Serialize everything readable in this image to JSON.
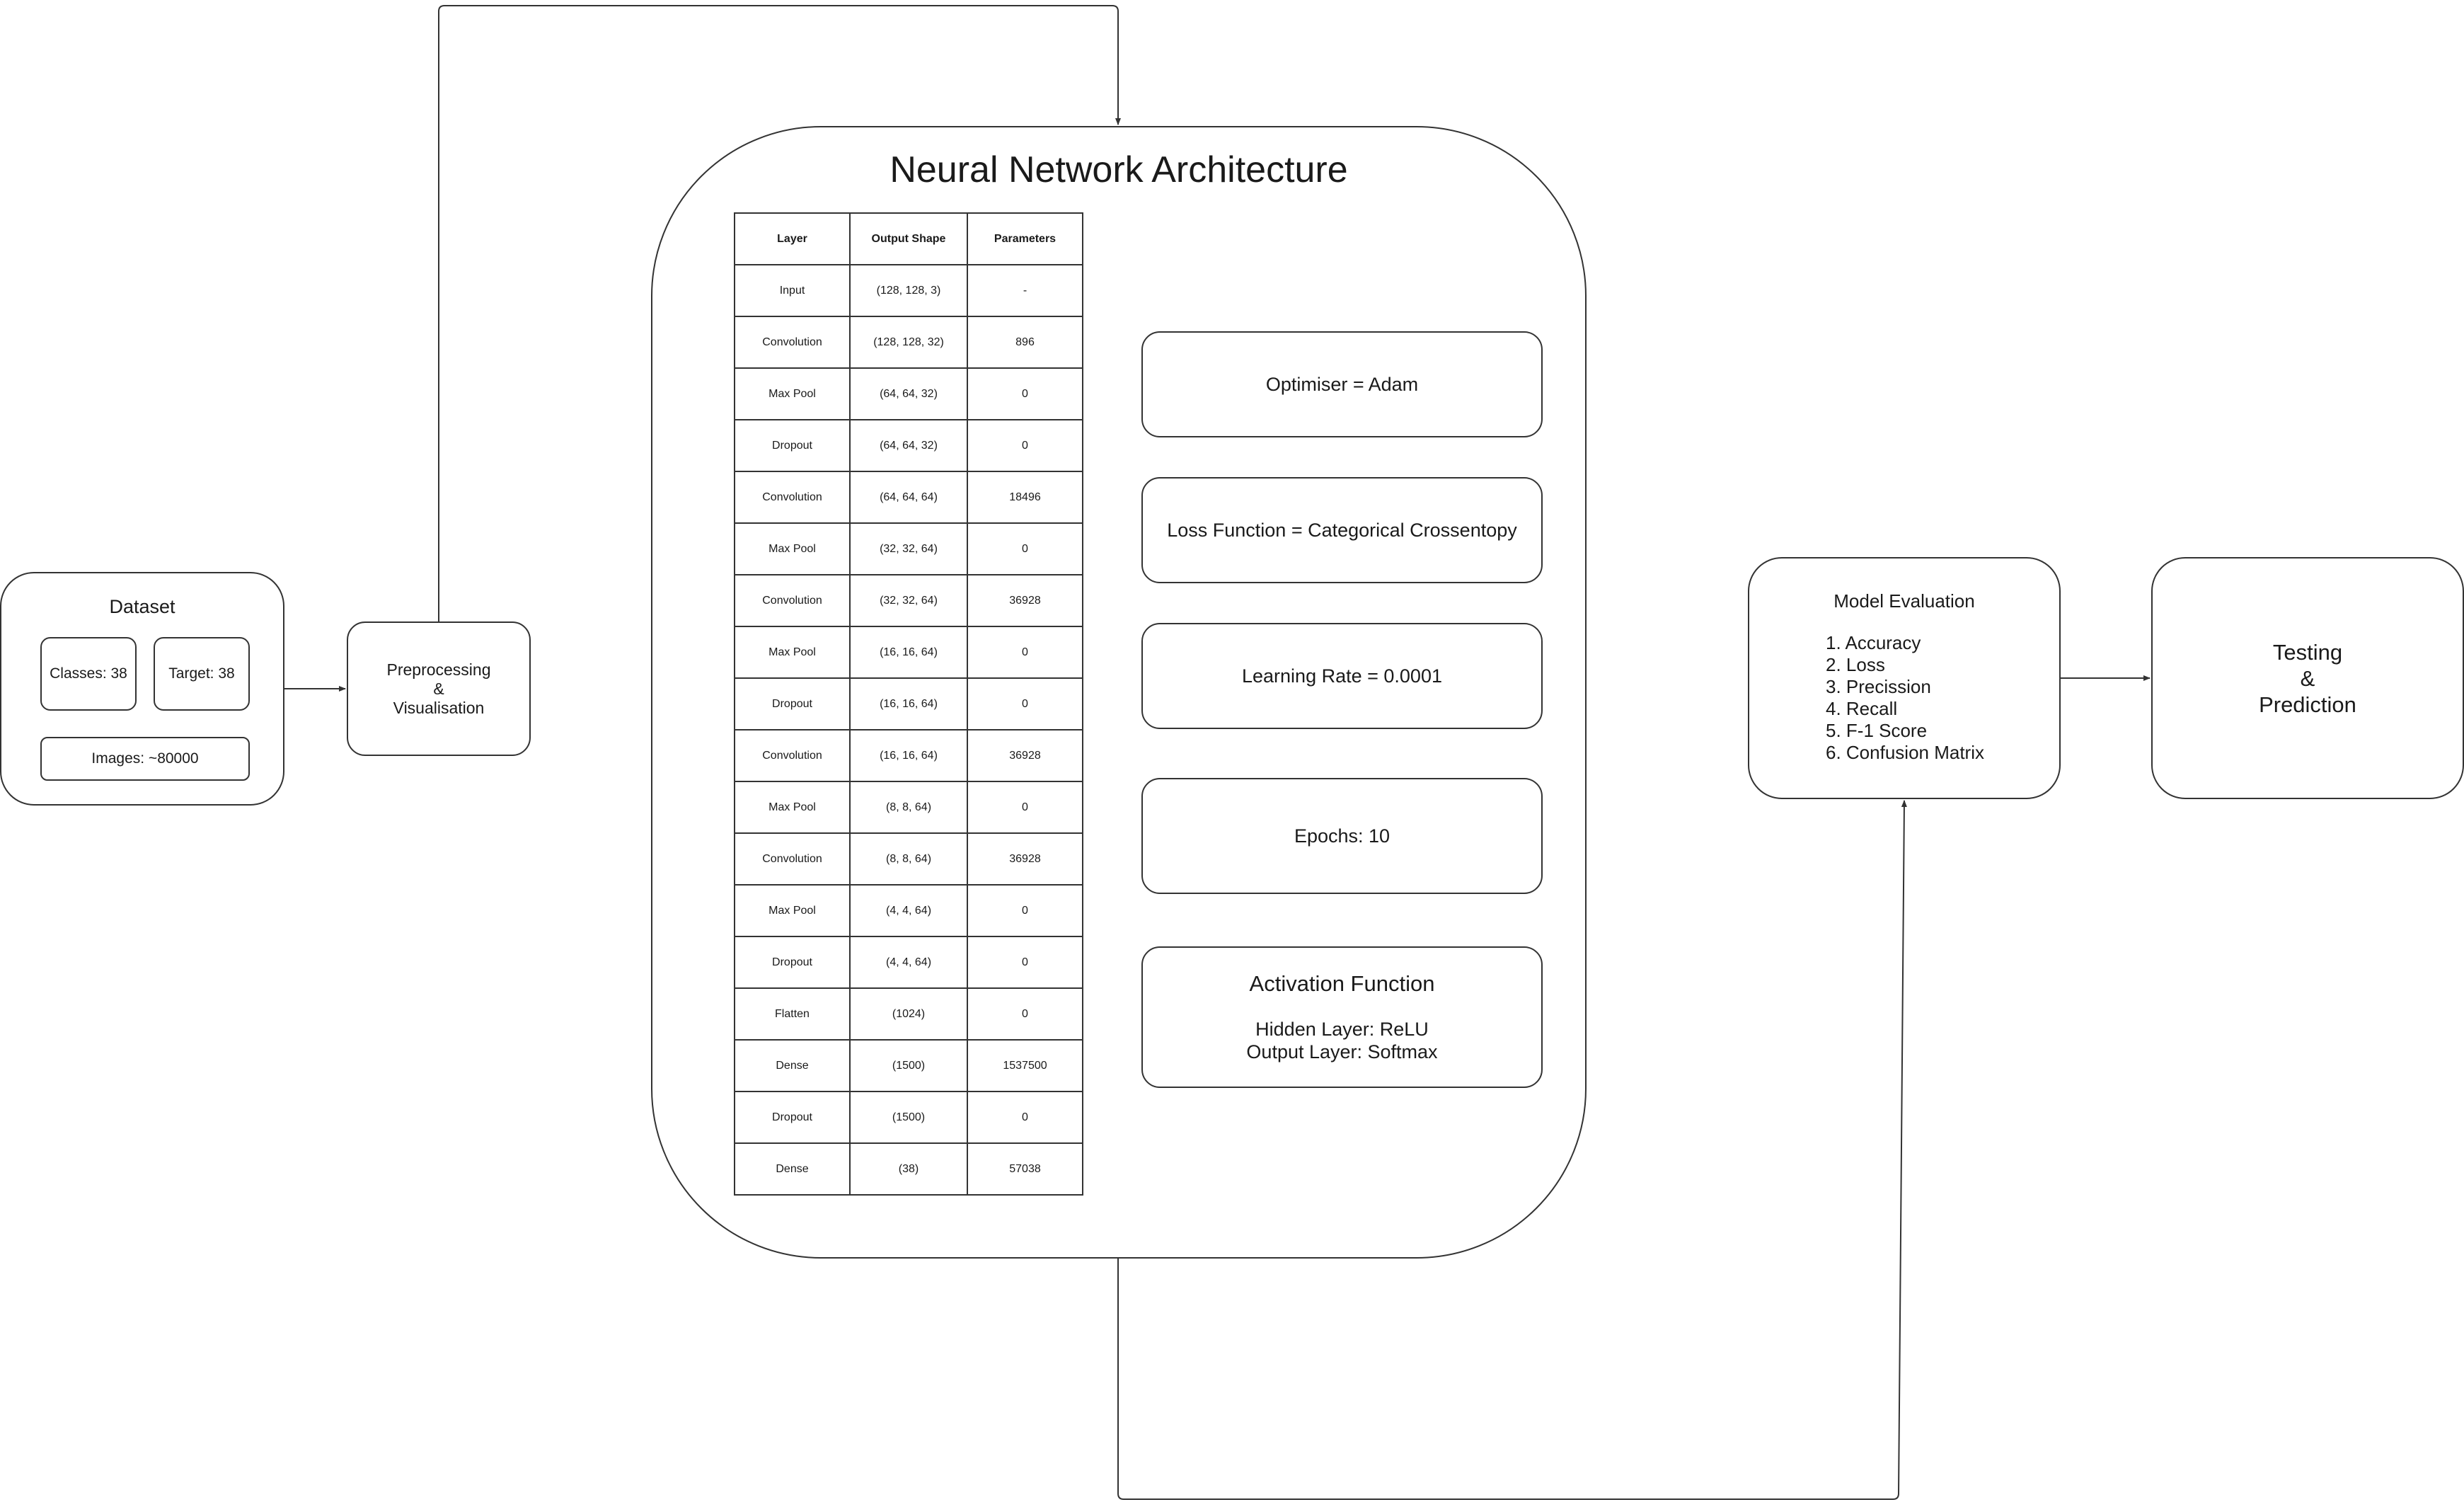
{
  "dataset": {
    "title": "Dataset",
    "classes": "Classes: 38",
    "target": "Target: 38",
    "images": "Images: ~80000"
  },
  "preprocessing": {
    "line1": "Preprocessing",
    "line2": "&",
    "line3": "Visualisation"
  },
  "architecture": {
    "title": "Neural Network Architecture",
    "columns": [
      "Layer",
      "Output Shape",
      "Parameters"
    ],
    "rows": [
      [
        "Input",
        "(128, 128, 3)",
        "-"
      ],
      [
        "Convolution",
        "(128, 128, 32)",
        "896"
      ],
      [
        "Max Pool",
        "(64, 64, 32)",
        "0"
      ],
      [
        "Dropout",
        "(64, 64, 32)",
        "0"
      ],
      [
        "Convolution",
        "(64, 64, 64)",
        "18496"
      ],
      [
        "Max Pool",
        "(32, 32, 64)",
        "0"
      ],
      [
        "Convolution",
        "(32, 32, 64)",
        "36928"
      ],
      [
        "Max Pool",
        "(16, 16, 64)",
        "0"
      ],
      [
        "Dropout",
        "(16, 16, 64)",
        "0"
      ],
      [
        "Convolution",
        "(16, 16, 64)",
        "36928"
      ],
      [
        "Max Pool",
        "(8, 8, 64)",
        "0"
      ],
      [
        "Convolution",
        "(8, 8, 64)",
        "36928"
      ],
      [
        "Max Pool",
        "(4, 4, 64)",
        "0"
      ],
      [
        "Dropout",
        "(4, 4, 64)",
        "0"
      ],
      [
        "Flatten",
        "(1024)",
        "0"
      ],
      [
        "Dense",
        "(1500)",
        "1537500"
      ],
      [
        "Dropout",
        "(1500)",
        "0"
      ],
      [
        "Dense",
        "(38)",
        "57038"
      ]
    ],
    "optimiser": "Optimiser = Adam",
    "loss_function": "Loss Function = Categorical Crossentopy",
    "learning_rate": "Learning Rate = 0.0001",
    "epochs": "Epochs: 10",
    "activation": {
      "title": "Activation Function",
      "hidden": "Hidden Layer: ReLU",
      "output": "Output Layer: Softmax"
    }
  },
  "evaluation": {
    "title": "Model Evaluation",
    "items": [
      "1. Accuracy",
      "2. Loss",
      "3. Precission",
      "4. Recall",
      "5. F-1 Score",
      "6. Confusion Matrix"
    ]
  },
  "testing": {
    "line1": "Testing",
    "line2": "&",
    "line3": "Prediction"
  }
}
